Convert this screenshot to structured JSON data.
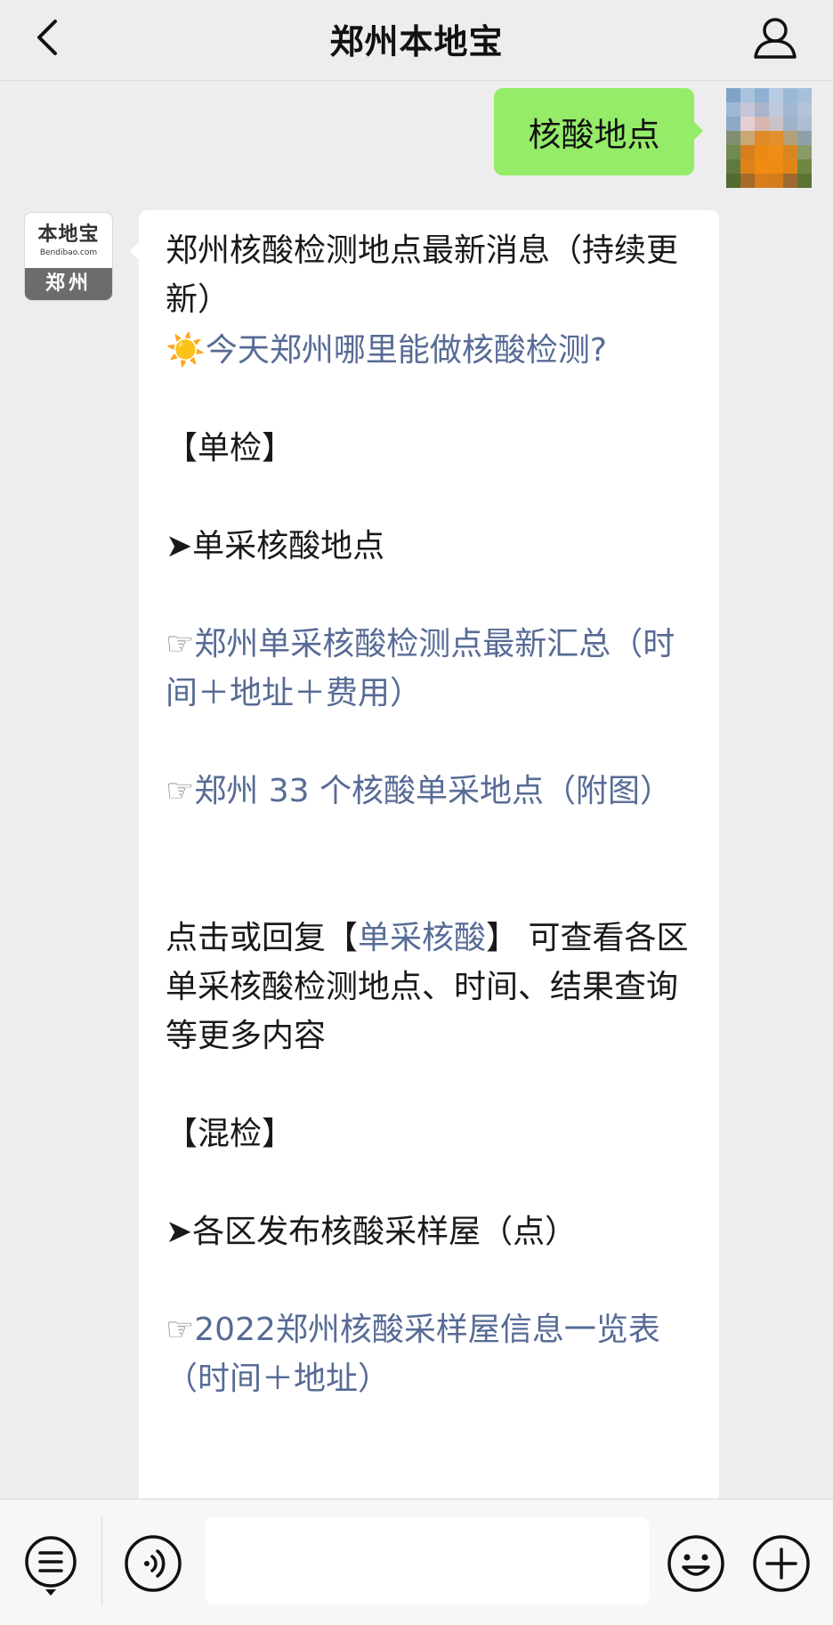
{
  "header": {
    "title": "郑州本地宝"
  },
  "user_message": {
    "text": "核酸地点"
  },
  "bot": {
    "avatar_logo": "本地宝",
    "avatar_url": "Bendibao.com",
    "avatar_city": "郑州"
  },
  "reply": {
    "intro": "郑州核酸检测地点最新消息（持续更新）",
    "sun_icon": "☀️",
    "today_link": "今天郑州哪里能做核酸检测?",
    "single_heading": "【单检】",
    "arrow_glyph": "➤",
    "single_sub": "单采核酸地点",
    "hand_glyph": "☞",
    "link_single_summary": "郑州单采核酸检测点最新汇总（时间＋地址＋费用）",
    "link_single_33": "郑州 33 个核酸单采地点（附图）",
    "click_text_before": "点击或回复【",
    "click_keyword": "单采核酸",
    "click_text_after": "】 可查看各区单采核酸检测地点、时间、结果查询等更多内容",
    "mixed_heading": "【混检】",
    "mixed_sub": "各区发布核酸采样屋（点）",
    "link_mixed_2022": "2022郑州核酸采样屋信息一览表（时间＋地址）"
  },
  "icons": {
    "back": "chevron-left-icon",
    "profile": "person-icon",
    "menu": "menu-list-icon",
    "voice": "voice-icon",
    "emoji": "emoji-icon",
    "plus": "plus-icon"
  },
  "colors": {
    "background": "#ededed",
    "user_bubble": "#95ec69",
    "link": "#576b95",
    "avatar_band": "#6c6c6c"
  }
}
